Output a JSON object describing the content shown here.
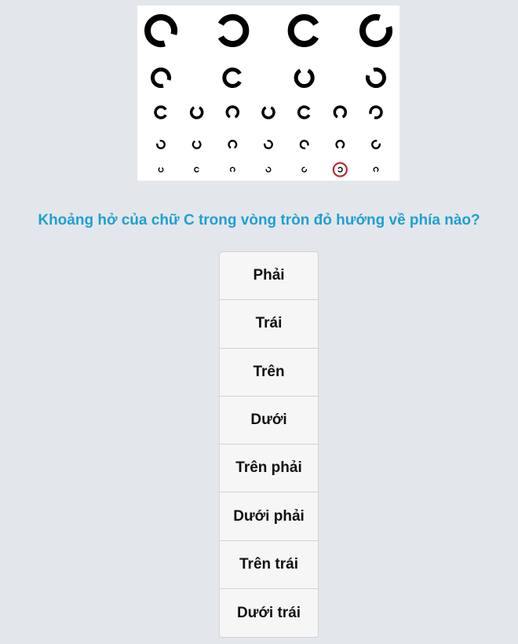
{
  "question": "Khoảng hở của chữ C trong vòng tròn đỏ hướng về phía nào?",
  "answers": [
    "Phải",
    "Trái",
    "Trên",
    "Dưới",
    "Trên phải",
    "Dưới phải",
    "Trên trái",
    "Dưới trái"
  ],
  "chart": {
    "rows": [
      [
        "down-right",
        "left",
        "right",
        "up-right"
      ],
      [
        "down-right",
        "right",
        "up",
        "up-left"
      ],
      [
        "right",
        "up",
        "down",
        "up",
        "right",
        "down",
        "down-left"
      ],
      [
        "up-left",
        "up",
        "down",
        "up-left",
        "down-right",
        "down",
        "up-right"
      ],
      [
        "up",
        "right",
        "down",
        "up-left",
        "up-right",
        "left",
        "down"
      ]
    ],
    "highlight": {
      "row": 4,
      "col": 5
    },
    "highlight_color": "#c0282e",
    "ink_color": "#000000"
  }
}
